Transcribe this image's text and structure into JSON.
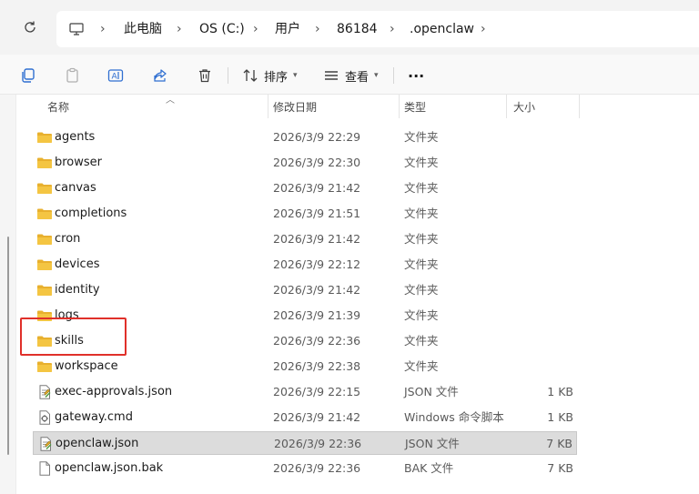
{
  "breadcrumb": [
    "此电脑",
    "OS (C:)",
    "用户",
    "86184",
    ".openclaw"
  ],
  "toolbar": {
    "sort_label": "排序",
    "view_label": "查看",
    "more_label": "···"
  },
  "columns": {
    "name": "名称",
    "modified": "修改日期",
    "type": "类型",
    "size": "大小"
  },
  "files": [
    {
      "name": "agents",
      "modified": "2026/3/9 22:29",
      "type": "文件夹",
      "size": "",
      "icon": "folder-icon"
    },
    {
      "name": "browser",
      "modified": "2026/3/9 22:30",
      "type": "文件夹",
      "size": "",
      "icon": "folder-icon"
    },
    {
      "name": "canvas",
      "modified": "2026/3/9 21:42",
      "type": "文件夹",
      "size": "",
      "icon": "folder-icon"
    },
    {
      "name": "completions",
      "modified": "2026/3/9 21:51",
      "type": "文件夹",
      "size": "",
      "icon": "folder-icon"
    },
    {
      "name": "cron",
      "modified": "2026/3/9 21:42",
      "type": "文件夹",
      "size": "",
      "icon": "folder-icon"
    },
    {
      "name": "devices",
      "modified": "2026/3/9 22:12",
      "type": "文件夹",
      "size": "",
      "icon": "folder-icon"
    },
    {
      "name": "identity",
      "modified": "2026/3/9 21:42",
      "type": "文件夹",
      "size": "",
      "icon": "folder-icon"
    },
    {
      "name": "logs",
      "modified": "2026/3/9 21:39",
      "type": "文件夹",
      "size": "",
      "icon": "folder-icon"
    },
    {
      "name": "skills",
      "modified": "2026/3/9 22:36",
      "type": "文件夹",
      "size": "",
      "icon": "folder-icon"
    },
    {
      "name": "workspace",
      "modified": "2026/3/9 22:38",
      "type": "文件夹",
      "size": "",
      "icon": "folder-icon"
    },
    {
      "name": "exec-approvals.json",
      "modified": "2026/3/9 22:15",
      "type": "JSON 文件",
      "size": "1 KB",
      "icon": "json-file-icon"
    },
    {
      "name": "gateway.cmd",
      "modified": "2026/3/9 21:42",
      "type": "Windows 命令脚本",
      "size": "1 KB",
      "icon": "cmd-file-icon"
    },
    {
      "name": "openclaw.json",
      "modified": "2026/3/9 22:36",
      "type": "JSON 文件",
      "size": "7 KB",
      "icon": "json-file-icon",
      "selected": true
    },
    {
      "name": "openclaw.json.bak",
      "modified": "2026/3/9 22:36",
      "type": "BAK 文件",
      "size": "7 KB",
      "icon": "blank-file-icon"
    }
  ],
  "colors": {
    "folder": "#f4c542",
    "highlight_box": "#e0302a",
    "selection": "#dcdcdc"
  }
}
